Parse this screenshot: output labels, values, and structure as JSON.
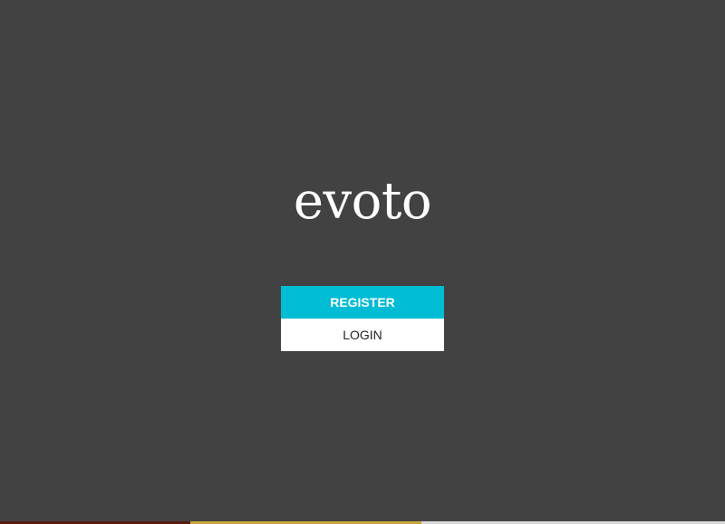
{
  "app": {
    "title": "evoto"
  },
  "auth": {
    "register_label": "REGISTER",
    "login_label": "LOGIN"
  },
  "colors": {
    "background": "#424242",
    "accent": "#00bcd4",
    "secondary_button": "#ffffff"
  }
}
